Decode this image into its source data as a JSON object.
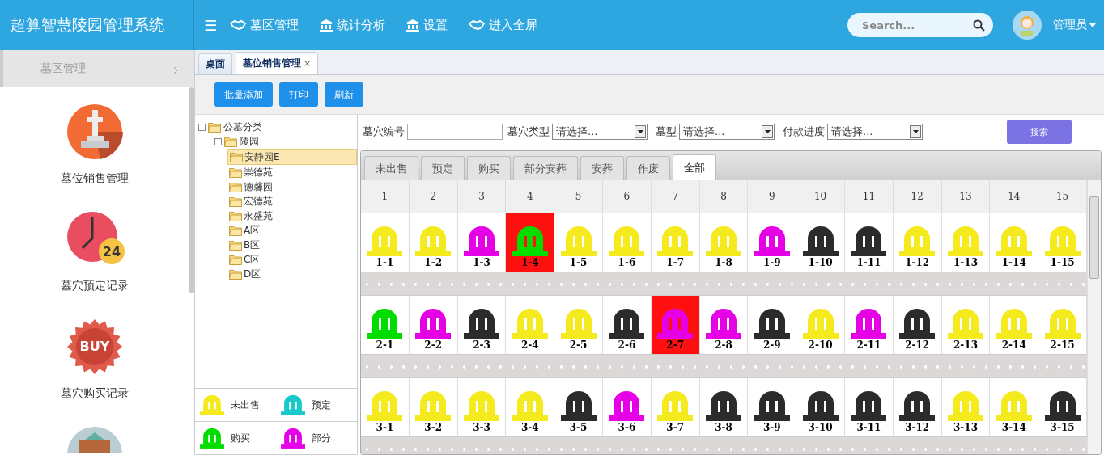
{
  "header": {
    "title": "超算智慧陵园管理系统",
    "menu_icon": "☰",
    "nav": [
      {
        "label": "墓区管理"
      },
      {
        "label": "统计分析"
      },
      {
        "label": "设置"
      },
      {
        "label": "进入全屏"
      }
    ],
    "search": {
      "placeholder": "Search..."
    },
    "user": "管理员"
  },
  "sidebar": {
    "section": "墓区管理",
    "items": [
      {
        "label": "墓位销售管理"
      },
      {
        "label": "墓穴预定记录",
        "badge": "24"
      },
      {
        "label": "墓穴购买记录",
        "badge": "BUY"
      }
    ]
  },
  "page_tabs": [
    {
      "label": "桌面",
      "selected": false
    },
    {
      "label": "墓位销售管理",
      "selected": true,
      "close": "×"
    }
  ],
  "toolbar": [
    "批量添加",
    "打印",
    "刷新"
  ],
  "tree": {
    "label": "公墓分类",
    "expanded": true,
    "children": [
      {
        "label": "陵园",
        "expanded": true,
        "children": [
          {
            "label": "安静园E",
            "selected": true
          },
          {
            "label": "崇德苑",
            "selected": false
          },
          {
            "label": "德馨园",
            "selected": false
          },
          {
            "label": "宏德苑",
            "selected": false
          },
          {
            "label": "永盛苑",
            "selected": false
          },
          {
            "label": "A区",
            "selected": false
          },
          {
            "label": "B区",
            "selected": false
          },
          {
            "label": "C区",
            "selected": false
          },
          {
            "label": "D区",
            "selected": false
          }
        ]
      }
    ]
  },
  "legend": [
    {
      "label": "未出售",
      "kind": "unsold"
    },
    {
      "label": "预定",
      "kind": "reserved"
    },
    {
      "label": "购买",
      "kind": "purchased"
    },
    {
      "label": "部分",
      "kind": "partial"
    }
  ],
  "filters": [
    {
      "label": "墓穴编号",
      "kind": "text"
    },
    {
      "label": "墓穴类型",
      "kind": "select",
      "value": "请选择..."
    },
    {
      "label": "墓型",
      "kind": "select",
      "value": "请选择..."
    },
    {
      "label": "付款进度",
      "kind": "select",
      "value": "请选择..."
    }
  ],
  "search_button": "搜索",
  "status_tabs": [
    {
      "label": "未出售",
      "selected": false
    },
    {
      "label": "预定",
      "selected": false
    },
    {
      "label": "购买",
      "selected": false
    },
    {
      "label": "部分安葬",
      "selected": false
    },
    {
      "label": "安葬",
      "selected": false
    },
    {
      "label": "作废",
      "selected": false
    },
    {
      "label": "全部",
      "selected": true
    }
  ],
  "grid": {
    "columns": [
      "1",
      "2",
      "3",
      "4",
      "5",
      "6",
      "7",
      "8",
      "9",
      "10",
      "11",
      "12",
      "13",
      "14",
      "15"
    ],
    "rows": [
      {
        "cells": [
          {
            "label": "1-1",
            "kind": "unsold",
            "selected": false
          },
          {
            "label": "1-2",
            "kind": "unsold",
            "selected": false
          },
          {
            "label": "1-3",
            "kind": "partial",
            "selected": false
          },
          {
            "label": "1-4",
            "kind": "purchased",
            "selected": true
          },
          {
            "label": "1-5",
            "kind": "unsold",
            "selected": false
          },
          {
            "label": "1-6",
            "kind": "unsold",
            "selected": false
          },
          {
            "label": "1-7",
            "kind": "unsold",
            "selected": false
          },
          {
            "label": "1-8",
            "kind": "unsold",
            "selected": false
          },
          {
            "label": "1-9",
            "kind": "partial",
            "selected": false
          },
          {
            "label": "1-10",
            "kind": "buried",
            "selected": false
          },
          {
            "label": "1-11",
            "kind": "buried",
            "selected": false
          },
          {
            "label": "1-12",
            "kind": "unsold",
            "selected": false
          },
          {
            "label": "1-13",
            "kind": "unsold",
            "selected": false
          },
          {
            "label": "1-14",
            "kind": "unsold",
            "selected": false
          },
          {
            "label": "1-15",
            "kind": "unsold",
            "selected": false
          }
        ]
      },
      {
        "cells": [
          {
            "label": "2-1",
            "kind": "purchased",
            "selected": false
          },
          {
            "label": "2-2",
            "kind": "partial",
            "selected": false
          },
          {
            "label": "2-3",
            "kind": "buried",
            "selected": false
          },
          {
            "label": "2-4",
            "kind": "unsold",
            "selected": false
          },
          {
            "label": "2-5",
            "kind": "unsold",
            "selected": false
          },
          {
            "label": "2-6",
            "kind": "buried",
            "selected": false
          },
          {
            "label": "2-7",
            "kind": "partial",
            "selected": true
          },
          {
            "label": "2-8",
            "kind": "partial",
            "selected": false
          },
          {
            "label": "2-9",
            "kind": "buried",
            "selected": false
          },
          {
            "label": "2-10",
            "kind": "unsold",
            "selected": false
          },
          {
            "label": "2-11",
            "kind": "partial",
            "selected": false
          },
          {
            "label": "2-12",
            "kind": "buried",
            "selected": false
          },
          {
            "label": "2-13",
            "kind": "unsold",
            "selected": false
          },
          {
            "label": "2-14",
            "kind": "unsold",
            "selected": false
          },
          {
            "label": "2-15",
            "kind": "unsold",
            "selected": false
          }
        ]
      },
      {
        "cells": [
          {
            "label": "3-1",
            "kind": "unsold",
            "selected": false
          },
          {
            "label": "3-2",
            "kind": "unsold",
            "selected": false
          },
          {
            "label": "3-3",
            "kind": "unsold",
            "selected": false
          },
          {
            "label": "3-4",
            "kind": "unsold",
            "selected": false
          },
          {
            "label": "3-5",
            "kind": "buried",
            "selected": false
          },
          {
            "label": "3-6",
            "kind": "partial",
            "selected": false
          },
          {
            "label": "3-7",
            "kind": "unsold",
            "selected": false
          },
          {
            "label": "3-8",
            "kind": "buried",
            "selected": false
          },
          {
            "label": "3-9",
            "kind": "buried",
            "selected": false
          },
          {
            "label": "3-10",
            "kind": "buried",
            "selected": false
          },
          {
            "label": "3-11",
            "kind": "buried",
            "selected": false
          },
          {
            "label": "3-12",
            "kind": "buried",
            "selected": false
          },
          {
            "label": "3-13",
            "kind": "unsold",
            "selected": false
          },
          {
            "label": "3-14",
            "kind": "unsold",
            "selected": false
          },
          {
            "label": "3-15",
            "kind": "buried",
            "selected": false
          }
        ]
      }
    ]
  }
}
